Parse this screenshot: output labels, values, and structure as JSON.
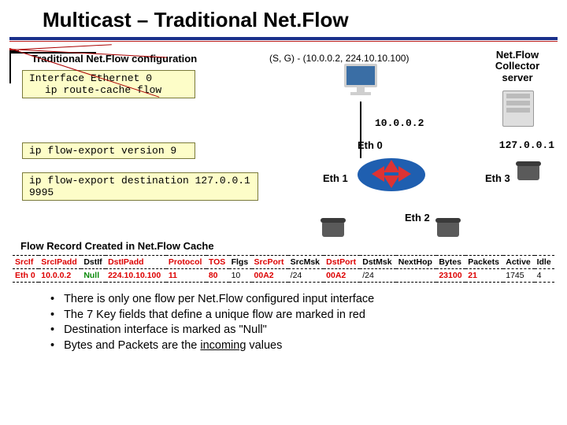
{
  "title": "Multicast – Traditional Net.Flow",
  "diagram": {
    "config_heading": "Traditional Net.Flow configuration",
    "sg_label": "(S, G) - (10.0.0.2, 224.10.10.100)",
    "server_label": "Net.Flow Collector server",
    "cfg1_line1": "Interface Ethernet 0",
    "cfg1_line2": "ip route-cache flow",
    "cfg2_line1": "ip flow-export version 9",
    "cfg3_line1": "ip flow-export destination 127.0.0.1 9995",
    "ip_src": "10.0.0.2",
    "ip_dst": "127.0.0.1",
    "eth0": "Eth 0",
    "eth1": "Eth 1",
    "eth2": "Eth 2",
    "eth3": "Eth 3"
  },
  "table_heading": "Flow Record Created in Net.Flow Cache",
  "headers": {
    "h0": "SrcIf",
    "h1": "SrcIPadd",
    "h2": "DstIf",
    "h3": "DstIPadd",
    "h4": "Protocol",
    "h5": "TOS",
    "h6": "Flgs",
    "h7": "SrcPort",
    "h8": "SrcMsk",
    "h9": "DstPort",
    "h10": "DstMsk",
    "h11": "NextHop",
    "h12": "Bytes",
    "h13": "Packets",
    "h14": "Active",
    "h15": "Idle"
  },
  "row": {
    "c0": "Eth 0",
    "c1": "10.0.0.2",
    "c2": "Null",
    "c3": "224.10.10.100",
    "c4": "11",
    "c5": "80",
    "c6": "10",
    "c7": "00A2",
    "c8": "/24",
    "c9": "00A2",
    "c10": "/24",
    "c11": "",
    "c12": "23100",
    "c13": "21",
    "c14": "1745",
    "c15": "4"
  },
  "bullets": {
    "b1a": "There is only one flow per Net.Flow configured input interface",
    "b2a": "The 7 Key fields that define a unique flow are marked in red",
    "b3a": "Destination interface is marked as \"Null\"",
    "b4a": "Bytes and Packets are the ",
    "b4b": "incoming",
    "b4c": " values"
  }
}
